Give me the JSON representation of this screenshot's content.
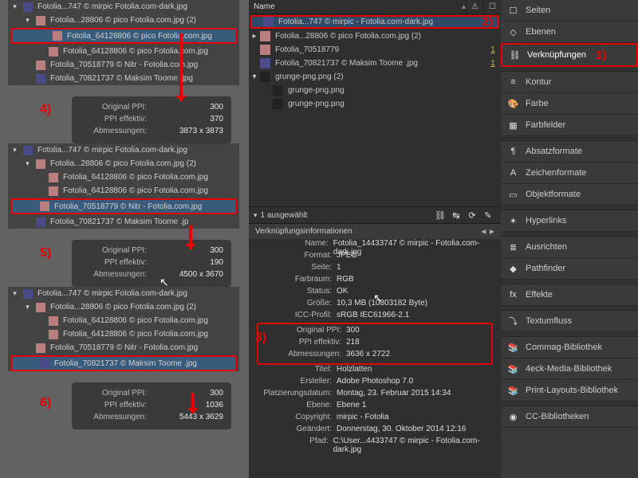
{
  "panels_left": [
    {
      "rows": [
        {
          "tri": "open",
          "thumb": "d",
          "label": "Fotolia...747 © mirpic  Fotolia.com-dark.jpg"
        },
        {
          "tri": "open",
          "thumb": "p",
          "label": "Fotolia...28806 © pico Fotolia.com.jpg (2)",
          "indent": 1
        },
        {
          "thumb": "p",
          "label": "Fotolia_64128806 © pico Fotolia.com.jpg",
          "indent": 2,
          "hi": true
        },
        {
          "thumb": "p",
          "label": "Fotolia_64128806 © pico Fotolia.com.jpg",
          "indent": 2
        },
        {
          "thumb": "p",
          "label": "Fotolia_70518779 © Nitr - Fotolia.com.jpg",
          "indent": 1
        },
        {
          "thumb": "d",
          "label": "Fotolia_70821737 © Maksim Toome .jpg",
          "indent": 1
        }
      ],
      "stats": {
        "ppi_orig": "300",
        "ppi_eff": "370",
        "dim": "3873 x 3873"
      },
      "badge": "4)"
    },
    {
      "rows": [
        {
          "tri": "open",
          "thumb": "d",
          "label": "Fotolia...747 © mirpic  Fotolia.com-dark.jpg"
        },
        {
          "tri": "open",
          "thumb": "p",
          "label": "Fotolia...28806 © pico Fotolia.com.jpg (2)",
          "indent": 1
        },
        {
          "thumb": "p",
          "label": "Fotolia_64128806 © pico Fotolia.com.jpg",
          "indent": 2
        },
        {
          "thumb": "p",
          "label": "Fotolia_64128806 © pico Fotolia.com.jpg",
          "indent": 2
        },
        {
          "thumb": "p",
          "label": "Fotolia_70518779 © Nitr - Fotolia.com.jpg",
          "indent": 1,
          "hi": true
        },
        {
          "thumb": "d",
          "label": "Fotolia_70821737 © Maksim Toome .jp",
          "indent": 1
        }
      ],
      "stats": {
        "ppi_orig": "300",
        "ppi_eff": "190",
        "dim": "4500 x 3670"
      },
      "badge": "5)"
    },
    {
      "rows": [
        {
          "tri": "open",
          "thumb": "d",
          "label": "Fotolia...747 © mirpic  Fotolia.com-dark.jpg"
        },
        {
          "tri": "open",
          "thumb": "p",
          "label": "Fotolia...28806 © pico Fotolia.com.jpg (2)",
          "indent": 1
        },
        {
          "thumb": "p",
          "label": "Fotolia_64128806 © pico Fotolia.com.jpg",
          "indent": 2
        },
        {
          "thumb": "p",
          "label": "Fotolia_64128806 © pico Fotolia.com.jpg",
          "indent": 2
        },
        {
          "thumb": "p",
          "label": "Fotolia_70518779 © Nitr - Fotolia.com.jpg",
          "indent": 1
        },
        {
          "thumb": "d",
          "label": "Fotolia_70821737 © Maksim Toome .jpg",
          "indent": 1,
          "hi": true
        }
      ],
      "stats": {
        "ppi_orig": "300",
        "ppi_eff": "1036",
        "dim": "5443 x 3629"
      },
      "badge": "6)"
    }
  ],
  "labels": {
    "original_ppi": "Original PPI:",
    "ppi_eff": "PPI effektiv:",
    "dim": "Abmessungen:"
  },
  "center": {
    "columns": {
      "name": "Name",
      "warn": "⚠",
      "page": "☐"
    },
    "rows": [
      {
        "tri": " ",
        "thumb": "d",
        "label": "Fotolia...747 © mirpic - Fotolia.com-dark.jpg",
        "hi": true,
        "badge": "2)"
      },
      {
        "tri": "▸",
        "thumb": "p",
        "label": "Fotolia...28806 © pico Fotolia.com.jpg (2)"
      },
      {
        "tri": " ",
        "thumb": "p",
        "label": "Fotolia_70518779",
        "ct": "1"
      },
      {
        "tri": " ",
        "thumb": "d",
        "label": "Fotolia_70821737 © Maksim Toome .jpg",
        "ct": "1"
      },
      {
        "tri": "▾",
        "thumb": "g",
        "label": "grunge-png.png (2)"
      },
      {
        "tri": " ",
        "thumb": "g",
        "label": "grunge-png.png",
        "child": true
      },
      {
        "tri": " ",
        "thumb": "g",
        "label": "grunge-png.png",
        "child": true
      }
    ],
    "selected_text": "1 ausgewählt",
    "info_title": "Verknüpfungsinformationen",
    "info": [
      {
        "k": "Name:",
        "v": "Fotolia_14433747 © mirpic - Fotolia.com-dark.jpg"
      },
      {
        "k": "Format:",
        "v": "JPEG"
      },
      {
        "k": "Seite:",
        "v": "1"
      },
      {
        "k": "Farbraum:",
        "v": "RGB"
      },
      {
        "k": "Status:",
        "v": "OK"
      },
      {
        "k": "Größe:",
        "v": "10,3 MB (10803182 Byte)"
      },
      {
        "k": "ICC-Profil:",
        "v": "sRGB IEC61966-2.1"
      }
    ],
    "ppi": [
      {
        "k": "Original PPI:",
        "v": "300"
      },
      {
        "k": "PPI effektiv:",
        "v": "218"
      },
      {
        "k": "Abmessungen:",
        "v": "3636 x 2722"
      }
    ],
    "info2": [
      {
        "k": "Titel:",
        "v": "Holzlatten"
      },
      {
        "k": "Ersteller:",
        "v": "Adobe Photoshop 7.0"
      },
      {
        "k": "Platzierungsdatum:",
        "v": "Montag, 23. Februar 2015 14:34"
      },
      {
        "k": "Ebene:",
        "v": "Ebene 1"
      },
      {
        "k": "Copyright:",
        "v": "mirpic - Fotolia"
      },
      {
        "k": "Geändert:",
        "v": "Donnerstag, 30. Oktober 2014 12:16"
      },
      {
        "k": "Pfad:",
        "v": "C:\\User...4433747 © mirpic - Fotolia.com-dark.jpg"
      }
    ],
    "badge3": "3)"
  },
  "right": [
    {
      "ic": "☐",
      "label": "Seiten"
    },
    {
      "ic": "◇",
      "label": "Ebenen"
    },
    {
      "ic": "⛓",
      "label": "Verknüpfungen",
      "hi": true,
      "num": "1)"
    },
    {
      "sep": true
    },
    {
      "ic": "≡",
      "label": "Kontur"
    },
    {
      "ic": "🎨",
      "label": "Farbe"
    },
    {
      "ic": "▦",
      "label": "Farbfelder"
    },
    {
      "sep": true
    },
    {
      "ic": "¶",
      "label": "Absatzformate"
    },
    {
      "ic": "A",
      "label": "Zeichenformate"
    },
    {
      "ic": "▭",
      "label": "Objektformate"
    },
    {
      "sep": true
    },
    {
      "ic": "✶",
      "label": "Hyperlinks"
    },
    {
      "sep": true
    },
    {
      "ic": "≣",
      "label": "Ausrichten"
    },
    {
      "ic": "◆",
      "label": "Pathfinder"
    },
    {
      "sep": true
    },
    {
      "ic": "fx",
      "label": "Effekte"
    },
    {
      "sep": true
    },
    {
      "ic": "⤵",
      "label": "Textumfluss"
    },
    {
      "sep": true
    },
    {
      "ic": "📚",
      "label": "Commag-Bibliothek"
    },
    {
      "ic": "📚",
      "label": "4eck-Media-Bibliothek"
    },
    {
      "ic": "📚",
      "label": "Print-Layouts-Bibliothek"
    },
    {
      "sep": true
    },
    {
      "ic": "◉",
      "label": "CC-Bibliotheken"
    }
  ]
}
